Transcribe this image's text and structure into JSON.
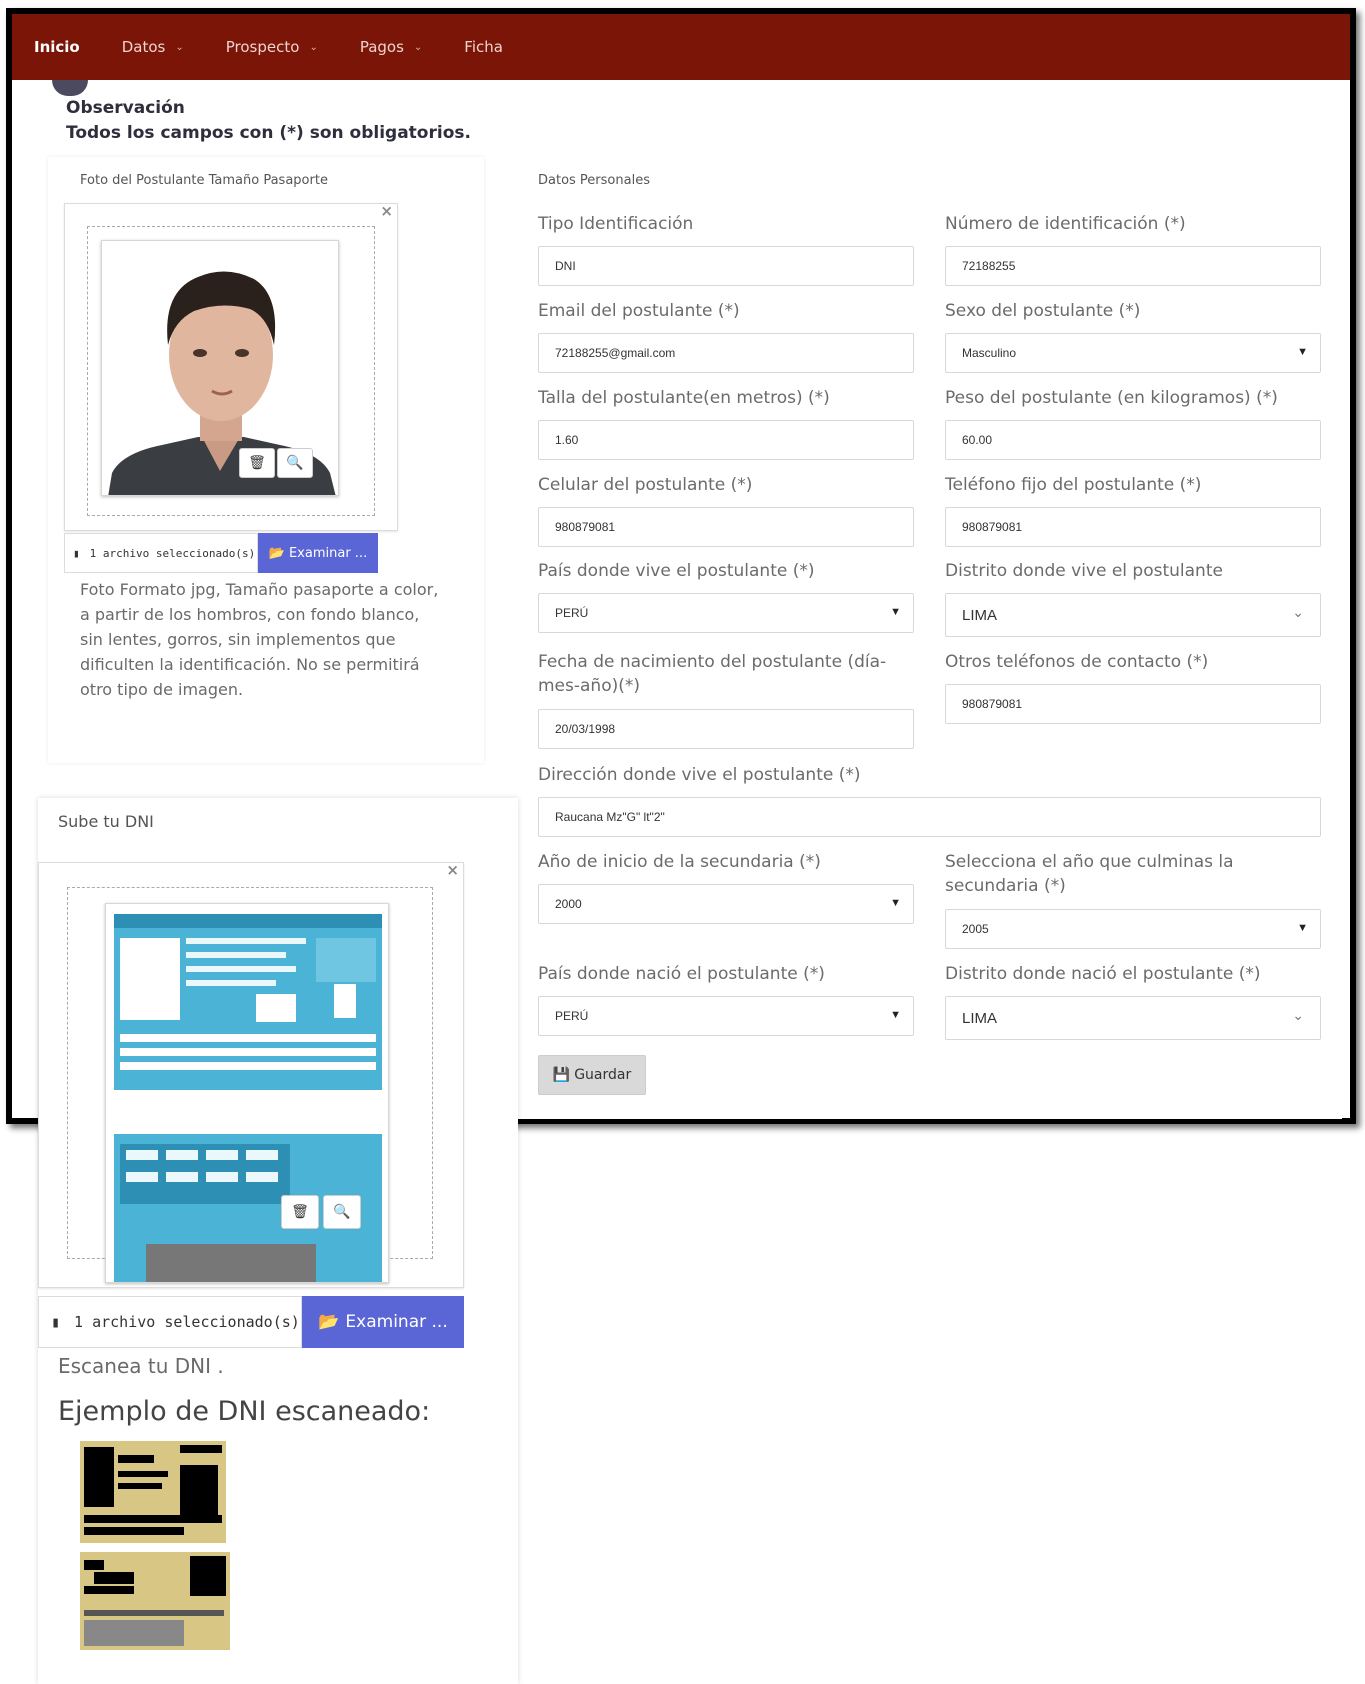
{
  "nav": {
    "items": [
      {
        "label": "Inicio"
      },
      {
        "label": "Datos"
      },
      {
        "label": "Prospecto"
      },
      {
        "label": "Pagos"
      },
      {
        "label": "Ficha"
      }
    ]
  },
  "observation": {
    "title": "Observación",
    "note": "Todos los campos con (*) son obligatorios."
  },
  "photo_card": {
    "title": "Foto del Postulante Tamaño Pasaporte",
    "close": "×",
    "file_caption": "1 archivo seleccionado(s)",
    "browse_label": "Examinar ...",
    "help": "Foto Formato jpg, Tamaño pasaporte a color, a partir de los hombros, con fondo blanco, sin lentes, gorros, sin implementos que dificulten la identificación. No se permitirá otro tipo de imagen."
  },
  "form": {
    "title": "Datos Personales",
    "tipo_id": {
      "label": "Tipo Identificación",
      "value": "DNI"
    },
    "num_id": {
      "label": "Número de identificación (*)",
      "value": "72188255"
    },
    "email": {
      "label": "Email del postulante (*)",
      "value": "72188255@gmail.com"
    },
    "sexo": {
      "label": "Sexo del postulante (*)",
      "value": "Masculino"
    },
    "talla": {
      "label": "Talla del postulante(en metros) (*)",
      "value": "1.60"
    },
    "peso": {
      "label": "Peso del postulante (en kilogramos) (*)",
      "value": "60.00"
    },
    "celular": {
      "label": "Celular del postulante (*)",
      "value": "980879081"
    },
    "fijo": {
      "label": "Teléfono fijo del postulante (*)",
      "value": "980879081"
    },
    "pais_vive": {
      "label": "País donde vive el postulante (*)",
      "value": "PERÚ"
    },
    "distrito_vive": {
      "label": "Distrito donde vive el postulante",
      "value": "LIMA"
    },
    "nacimiento": {
      "label": "Fecha de nacimiento del postulante (día-mes-año)(*)",
      "value": "20/03/1998"
    },
    "otros_tel": {
      "label": "Otros teléfonos de contacto (*)",
      "value": "980879081"
    },
    "direccion": {
      "label": "Dirección donde vive el postulante (*)",
      "value": "Raucana Mz\"G\"  lt\"2\""
    },
    "inicio_sec": {
      "label": "Año de inicio de la secundaria (*)",
      "value": "2000"
    },
    "fin_sec": {
      "label": "Selecciona el año que culminas la secundaria (*)",
      "value": "2005"
    },
    "pais_nac": {
      "label": "País donde nació el postulante (*)",
      "value": "PERÚ"
    },
    "distrito_nac": {
      "label": "Distrito donde nació el postulante (*)",
      "value": "LIMA"
    },
    "save_label": "Guardar"
  },
  "dni_card": {
    "title": "Sube tu DNI",
    "close": "×",
    "file_caption": "1 archivo seleccionado(s)",
    "browse_label": "Examinar ...",
    "scan_hint": "Escanea tu DNI .",
    "example_heading": "Ejemplo de DNI escaneado:"
  },
  "colors": {
    "navbar": "#7a1508",
    "browse_button": "#5a66d6",
    "dni_blue": "#4ab3d6"
  },
  "icons": [
    "file-icon",
    "folder-open-icon",
    "trash-icon",
    "zoom-icon",
    "floppy-icon",
    "chevron-down-icon",
    "caret-down-icon"
  ]
}
